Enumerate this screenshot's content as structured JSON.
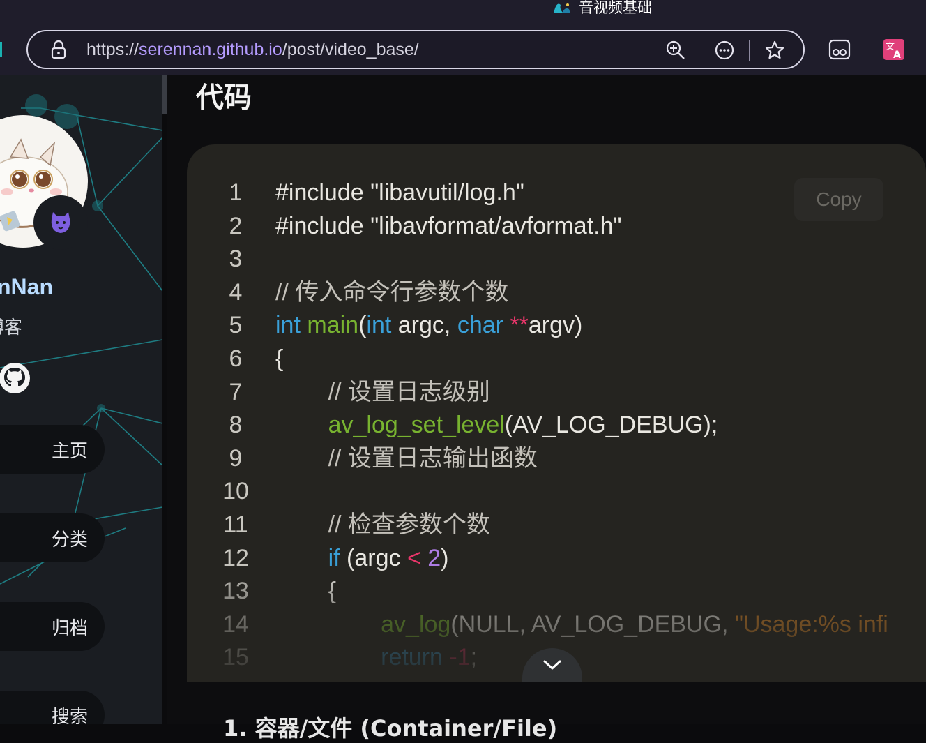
{
  "browser": {
    "tab_title": "音视频基础",
    "url_scheme": "https://",
    "url_host": "serennan.github.io",
    "url_path": "/post/video_base/"
  },
  "sidebar": {
    "site_name": "nNan",
    "site_subtitle": "博客",
    "nav": [
      {
        "label": "主页"
      },
      {
        "label": "分类"
      },
      {
        "label": "归档"
      },
      {
        "label": "搜索"
      }
    ]
  },
  "main": {
    "heading": "代码",
    "copy_label": "Copy",
    "next_heading": "1. 容器/文件 (Container/File)"
  },
  "code": [
    {
      "n": "1",
      "tokens": [
        {
          "t": "#include \"libavutil/log.h\"",
          "c": ""
        }
      ]
    },
    {
      "n": "2",
      "tokens": [
        {
          "t": "#include \"libavformat/avformat.h\"",
          "c": ""
        }
      ]
    },
    {
      "n": "3",
      "tokens": []
    },
    {
      "n": "4",
      "tokens": [
        {
          "t": "// 传入命令行参数个数",
          "c": "c-comment"
        }
      ]
    },
    {
      "n": "5",
      "tokens": [
        {
          "t": "int",
          "c": "c-kw"
        },
        {
          "t": " ",
          "c": ""
        },
        {
          "t": "main",
          "c": "c-fn"
        },
        {
          "t": "(",
          "c": ""
        },
        {
          "t": "int",
          "c": "c-kw"
        },
        {
          "t": " argc, ",
          "c": ""
        },
        {
          "t": "char",
          "c": "c-kw"
        },
        {
          "t": " ",
          "c": ""
        },
        {
          "t": "**",
          "c": "c-op"
        },
        {
          "t": "argv)",
          "c": ""
        }
      ]
    },
    {
      "n": "6",
      "tokens": [
        {
          "t": "{",
          "c": ""
        }
      ]
    },
    {
      "n": "7",
      "tokens": [
        {
          "t": "        // 设置日志级别",
          "c": "c-comment"
        }
      ]
    },
    {
      "n": "8",
      "tokens": [
        {
          "t": "        ",
          "c": ""
        },
        {
          "t": "av_log_set_level",
          "c": "c-fn"
        },
        {
          "t": "(AV_LOG_DEBUG);",
          "c": ""
        }
      ]
    },
    {
      "n": "9",
      "tokens": [
        {
          "t": "        // 设置日志输出函数",
          "c": "c-comment"
        }
      ]
    },
    {
      "n": "10",
      "tokens": []
    },
    {
      "n": "11",
      "tokens": [
        {
          "t": "        // 检查参数个数",
          "c": "c-comment"
        }
      ]
    },
    {
      "n": "12",
      "tokens": [
        {
          "t": "        ",
          "c": ""
        },
        {
          "t": "if",
          "c": "c-kw"
        },
        {
          "t": " (argc ",
          "c": ""
        },
        {
          "t": "<",
          "c": "c-op"
        },
        {
          "t": " ",
          "c": ""
        },
        {
          "t": "2",
          "c": "c-num"
        },
        {
          "t": ")",
          "c": ""
        }
      ]
    },
    {
      "n": "13",
      "tokens": [
        {
          "t": "        {",
          "c": ""
        }
      ]
    },
    {
      "n": "14",
      "tokens": [
        {
          "t": "                ",
          "c": ""
        },
        {
          "t": "av_log",
          "c": "c-fn"
        },
        {
          "t": "(NULL, AV_LOG_DEBUG, ",
          "c": ""
        },
        {
          "t": "\"Usage:%s infi",
          "c": "c-str"
        }
      ]
    },
    {
      "n": "15",
      "tokens": [
        {
          "t": "                ",
          "c": ""
        },
        {
          "t": "return",
          "c": "c-kw"
        },
        {
          "t": " ",
          "c": ""
        },
        {
          "t": "-1",
          "c": "c-op"
        },
        {
          "t": ";",
          "c": ""
        }
      ]
    }
  ]
}
